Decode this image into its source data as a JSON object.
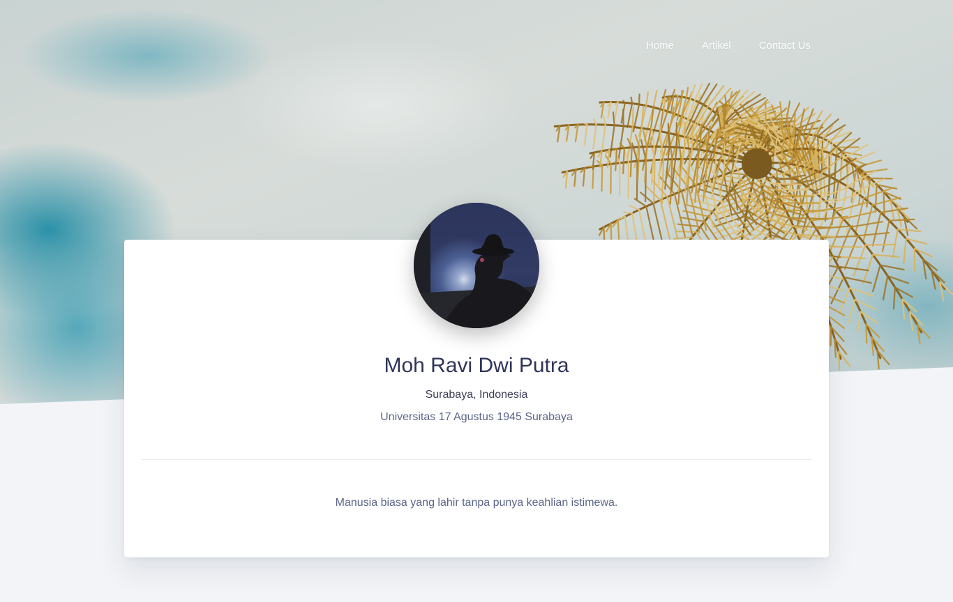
{
  "nav": {
    "items": [
      {
        "label": "Home"
      },
      {
        "label": "Artikel"
      },
      {
        "label": "Contact Us"
      }
    ]
  },
  "profile": {
    "name": "Moh Ravi Dwi Putra",
    "location": "Surabaya, Indonesia",
    "institution": "Universitas 17 Agustus 1945 Surabaya",
    "bio": "Manusia biasa yang lahir tanpa punya keahlian istimewa."
  },
  "colors": {
    "page_background": "#f2f4f7",
    "card_background": "#ffffff",
    "name_text": "#2f3558",
    "muted_text": "#5a6588",
    "sky_teal": "#228da5",
    "palm_gold": "#c79a3a"
  },
  "icons": {
    "avatar": "profile-photo-silhouette",
    "hero": "palm-tree-sky-photo"
  }
}
